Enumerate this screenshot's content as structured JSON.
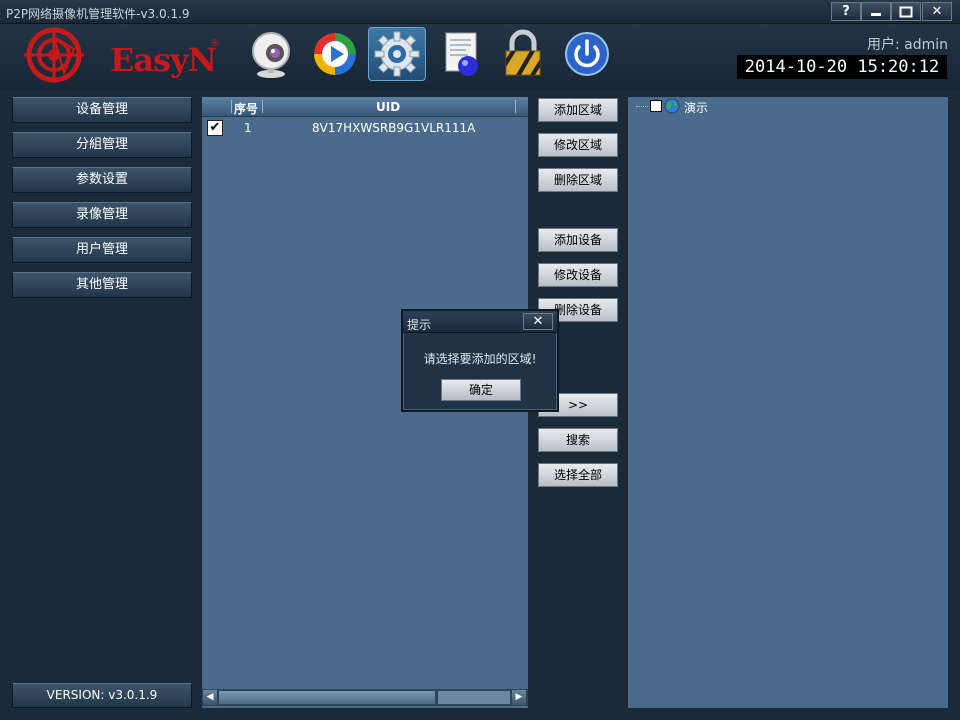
{
  "window": {
    "title": "P2P网络摄像机管理软件-v3.0.1.9",
    "buttons": [
      "?",
      "▬",
      "▭",
      "✕"
    ]
  },
  "header": {
    "brand": "EasyN",
    "brand_mark": "®",
    "toolbar_icons": [
      "webcam-icon",
      "playback-icon",
      "settings-icon",
      "log-icon",
      "lock-icon",
      "power-icon"
    ],
    "active_tool": "settings-icon",
    "user_label": "用户: admin",
    "datetime": "2014-10-20  15:20:12"
  },
  "sidebar": {
    "items": [
      {
        "label": "设备管理"
      },
      {
        "label": "分組管理"
      },
      {
        "label": "参数设置"
      },
      {
        "label": "录像管理"
      },
      {
        "label": "用户管理"
      },
      {
        "label": "其他管理"
      }
    ],
    "version": "VERSION: v3.0.1.9"
  },
  "device_table": {
    "columns": [
      "序号",
      "UID"
    ],
    "rows": [
      {
        "checked": true,
        "seq": "1",
        "uid": "8V17HXWSRB9G1VLR111A"
      }
    ]
  },
  "actions": {
    "add_area": "添加区域",
    "edit_area": "修改区域",
    "delete_area": "删除区域",
    "add_device": "添加设备",
    "edit_device": "修改设备",
    "delete_device": "删除设备",
    "move": ">>",
    "search": "搜索",
    "select_all": "选择全部"
  },
  "tree": {
    "root_label": "演示",
    "root_checked": false
  },
  "dialog": {
    "title": "提示",
    "close": "✕",
    "message": "请选择要添加的区域!",
    "ok": "确定"
  },
  "colors": {
    "panel": "#4b6b8c",
    "background": "#1b2a38",
    "brand_red": "#c61a1a"
  }
}
